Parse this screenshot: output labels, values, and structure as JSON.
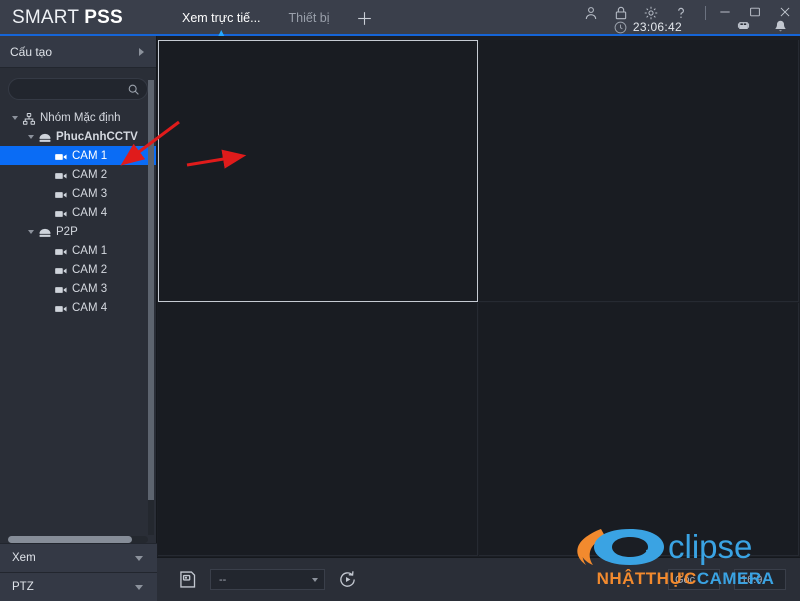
{
  "app": {
    "brand_first": "SMART ",
    "brand_second": "PSS"
  },
  "titlebar": {
    "tabs": [
      {
        "label": "Xem trực tiế...",
        "active": true
      },
      {
        "label": "Thiết bị",
        "active": false
      }
    ],
    "add_tab_label": "+",
    "icons": [
      {
        "name": "user-icon",
        "glyph": "user"
      },
      {
        "name": "lock-icon",
        "glyph": "lock"
      },
      {
        "name": "gear-icon",
        "glyph": "gear"
      },
      {
        "name": "help-icon",
        "glyph": "question"
      }
    ],
    "window_buttons": [
      {
        "name": "minimize-button",
        "glyph": "minimize"
      },
      {
        "name": "maximize-button",
        "glyph": "maximize"
      },
      {
        "name": "close-button",
        "glyph": "close"
      }
    ],
    "clock_time": "23:06:42",
    "status_icons": [
      {
        "name": "monitor-icon",
        "glyph": "monitor"
      },
      {
        "name": "bell-icon",
        "glyph": "bell"
      }
    ]
  },
  "sidebar": {
    "panel_title": "Cấu tạo",
    "search": {
      "value": "",
      "placeholder": ""
    },
    "tree": [
      {
        "label": "Nhóm Mặc định",
        "depth": 0,
        "icon": "group-icon",
        "caret": true,
        "selected": false,
        "bold": false
      },
      {
        "label": "PhucAnhCCTV",
        "depth": 1,
        "icon": "device-icon",
        "caret": true,
        "selected": false,
        "bold": true
      },
      {
        "label": "CAM 1",
        "depth": 2,
        "icon": "camera-icon",
        "caret": false,
        "selected": true,
        "bold": false
      },
      {
        "label": "CAM 2",
        "depth": 2,
        "icon": "camera-icon",
        "caret": false,
        "selected": false,
        "bold": false
      },
      {
        "label": "CAM 3",
        "depth": 2,
        "icon": "camera-icon",
        "caret": false,
        "selected": false,
        "bold": false
      },
      {
        "label": "CAM 4",
        "depth": 2,
        "icon": "camera-icon",
        "caret": false,
        "selected": false,
        "bold": false
      },
      {
        "label": "P2P",
        "depth": 1,
        "icon": "device-icon",
        "caret": true,
        "selected": false,
        "bold": false
      },
      {
        "label": "CAM 1",
        "depth": 2,
        "icon": "camera-icon",
        "caret": false,
        "selected": false,
        "bold": false
      },
      {
        "label": "CAM 2",
        "depth": 2,
        "icon": "camera-icon",
        "caret": false,
        "selected": false,
        "bold": false
      },
      {
        "label": "CAM 3",
        "depth": 2,
        "icon": "camera-icon",
        "caret": false,
        "selected": false,
        "bold": false
      },
      {
        "label": "CAM 4",
        "depth": 2,
        "icon": "camera-icon",
        "caret": false,
        "selected": false,
        "bold": false
      }
    ],
    "accordions": [
      {
        "label": "Xem"
      },
      {
        "label": "PTZ"
      }
    ]
  },
  "stage": {
    "cells": [
      {
        "id": "c1",
        "selected": true,
        "label": ""
      },
      {
        "id": "c2",
        "selected": false,
        "label": ""
      },
      {
        "id": "c3",
        "selected": false,
        "label": ""
      },
      {
        "id": "c4",
        "selected": false,
        "label": ""
      }
    ]
  },
  "bottombar": {
    "snapshot_icon": "snapshot-icon",
    "stream_select": {
      "value": "--"
    },
    "replay_icon": "replay-icon",
    "ratio_select": {
      "value": "Gốc"
    },
    "ratio_alt": "16:9"
  },
  "branding": {
    "logo_text": "clipse",
    "watermark_parts": [
      {
        "text": "NHẬT ",
        "color": "orange"
      },
      {
        "text": "THỰC ",
        "color": "orange"
      },
      {
        "text": "CAMERA",
        "color": "blue"
      }
    ]
  },
  "colors": {
    "accent_blue": "#0a6cf5",
    "titlebar": "#3a3f4b",
    "sidebar": "#2a2e37",
    "stage": "#1b1e24",
    "arrow_red": "#e01b1b",
    "logo_orange": "#f28a2e",
    "logo_blue": "#3aa3e3"
  }
}
